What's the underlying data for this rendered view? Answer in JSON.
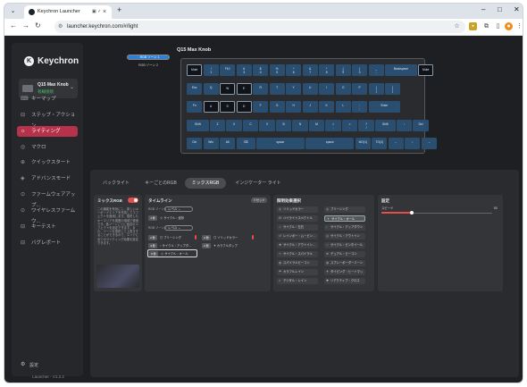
{
  "browser": {
    "tab_title": "Keychron Launcher",
    "tab_icon": "group-tab-icon",
    "new_tab": "+",
    "url": "launcher.keychron.com/#/light",
    "window": {
      "minimize": "–",
      "maximize": "□",
      "close": "✕"
    }
  },
  "app": {
    "brand": "Keychron",
    "device": {
      "name": "Q15 Max Knob",
      "status": "有線接続"
    },
    "nav": [
      {
        "label": "キーマップ",
        "icon": "keyboard-icon"
      },
      {
        "label": "ステップ・アクション",
        "icon": "step-icon"
      },
      {
        "label": "ライティング",
        "icon": "light-icon",
        "active": true
      },
      {
        "label": "マクロ",
        "icon": "macro-icon"
      },
      {
        "label": "クイックスタート",
        "icon": "quickstart-icon"
      },
      {
        "label": "アドバンスモード",
        "icon": "advanced-icon"
      },
      {
        "label": "ファームウェアアップ...",
        "icon": "firmware-icon"
      },
      {
        "label": "ワイヤレスファームウ...",
        "icon": "wireless-icon"
      },
      {
        "label": "キーテスト",
        "icon": "keytest-icon"
      },
      {
        "label": "バグレポート",
        "icon": "bug-icon"
      }
    ],
    "settings": "設定",
    "version": "Launcher - V1.2.2"
  },
  "keyboard": {
    "title": "Q15 Max Knob",
    "layers": [
      "RGB ゾーン 1",
      "RGB ゾーン 2"
    ],
    "rows": [
      [
        "Mute",
        "!\n1",
        "F10",
        "#\n3",
        "$\n4",
        "%\n5",
        "^\n6",
        "&\n7",
        "*\n8",
        "(\n9",
        ")\n0",
        "_\n-",
        "Backspace",
        "Mute"
      ],
      [
        "Esc",
        "Q",
        "W",
        "E",
        "R",
        "T",
        "Y",
        "U",
        "I",
        "O",
        "P",
        "{\n[",
        "}\n]"
      ],
      [
        "Fn",
        "A",
        "S",
        "D",
        "F",
        "G",
        "H",
        "J",
        "K",
        "L",
        ":\n;",
        "Enter"
      ],
      [
        "Shift",
        "Z",
        "X",
        "C",
        "V",
        "B",
        "N",
        "M",
        "<\n,",
        ">\n.",
        "?\n/",
        "Shift",
        "↑",
        "Del"
      ],
      [
        "Ctrl",
        "Win",
        "Alt",
        "⌫",
        "space",
        "space",
        "MO(1)",
        "TG(2)",
        "←",
        "↓",
        "→"
      ]
    ]
  },
  "panel": {
    "tabs": [
      "バックライト",
      "キーごとのRGB",
      "ミックスRGB",
      "インジケーター ライト"
    ],
    "mix_rgb": {
      "title": "ミックスRGB",
      "enabled": true,
      "description": "この機能を有効にし、新しいキーボードエリアを作成してエフェクトを適用します。選択したキーエリアを複数の領域で使用でき、各ゾーンごとに独自のエフェクトを設定できます。また、ゾーンを選択して上書きすることができるので、エリアに全てのライティング効果を設定できます。"
    },
    "timeline": {
      "title": "タイムライン",
      "reset": "リセット",
      "zones": [
        {
          "label": "RGB ゾーン 1",
          "mode": "レベル",
          "items": [
            {
              "tag": "1 秒",
              "name": "サイクル・波状"
            }
          ]
        },
        {
          "label": "RGB ゾーン 2",
          "mode": "レベル",
          "items": [
            {
              "tag": "2 秒",
              "name": "ブリーシング"
            },
            {
              "tag": "2 秒",
              "name": "ソリッドカラー"
            },
            {
              "tag": "3 秒",
              "name": "サイクル・アップダ..."
            },
            {
              "tag": "2 秒",
              "name": "カラフルタップ"
            },
            {
              "tag": "6 秒",
              "name": "サイクル・オール"
            }
          ]
        }
      ]
    },
    "effects": {
      "title": "照明効果選択",
      "items": [
        [
          "ソリッドカラー",
          "ブリーシング"
        ],
        [
          "ハイライトスペクトル",
          "サイクル・オール"
        ],
        [
          "サイクル・左右",
          "サイクル・アップダウン"
        ],
        [
          "レインボー・ムービン...",
          "サイクル・アウトイン"
        ],
        [
          "サイクル・アウトイン...",
          "サイクル・ピンホイール"
        ],
        [
          "サイクル・スパイラル",
          "デュアル・ビーコン"
        ],
        [
          "スパイラルビーコン",
          "スプレーボーダーミーン"
        ],
        [
          "カラフルレイン",
          "タイピング・ヒートマップ"
        ],
        [
          "デジタル・レイン",
          "リアクティブ・クロス"
        ]
      ],
      "selected": "サイクル・オール"
    },
    "settings": {
      "title": "設定",
      "speed_label": "スピード",
      "speed_value": "50",
      "speed_fraction": 0.1
    }
  }
}
